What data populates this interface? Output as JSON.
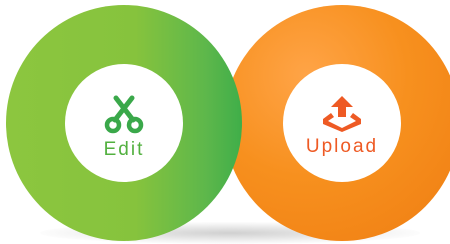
{
  "edit": {
    "label": "Edit",
    "icon": "scissors-icon",
    "color": "#52b03f"
  },
  "upload": {
    "label": "Upload",
    "icon": "upload-tray-icon",
    "color": "#ee5a24"
  },
  "colors": {
    "green_ring": "#86c33d",
    "orange_ring": "#f7901e"
  }
}
